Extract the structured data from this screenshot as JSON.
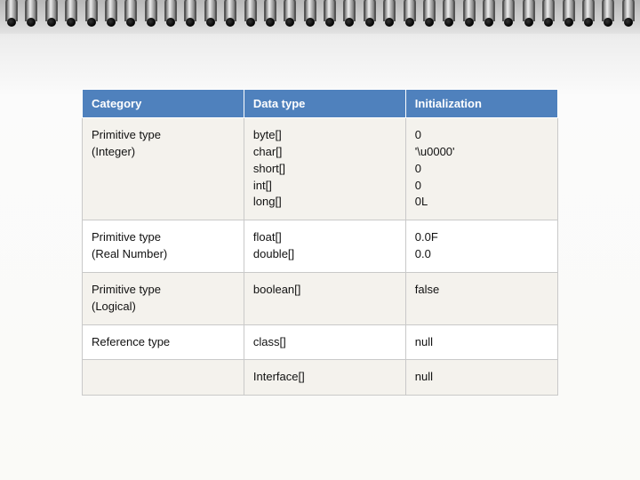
{
  "table": {
    "headers": {
      "category": "Category",
      "datatype": "Data type",
      "init": "Initialization"
    },
    "rows": [
      {
        "category": [
          "Primitive type",
          "(Integer)"
        ],
        "datatype": [
          "byte[]",
          "char[]",
          "short[]",
          "int[]",
          "long[]"
        ],
        "init": [
          "0",
          "'\\u0000'",
          "0",
          "0",
          "0L"
        ],
        "shade": true
      },
      {
        "category": [
          "Primitive type",
          "(Real Number)"
        ],
        "datatype": [
          "float[]",
          "double[]"
        ],
        "init": [
          "0.0F",
          "0.0"
        ],
        "shade": false
      },
      {
        "category": [
          "Primitive type",
          "(Logical)"
        ],
        "datatype": [
          "boolean[]"
        ],
        "init": [
          "false"
        ],
        "shade": true
      },
      {
        "category": [
          "Reference type"
        ],
        "datatype": [
          "class[]"
        ],
        "init": [
          "null"
        ],
        "shade": false
      },
      {
        "category": [
          ""
        ],
        "datatype": [
          "Interface[]"
        ],
        "init": [
          "null"
        ],
        "shade": true,
        "hide_category": true
      }
    ]
  },
  "chart_data": {
    "type": "table",
    "title": "",
    "columns": [
      "Category",
      "Data type",
      "Initialization"
    ],
    "rows": [
      [
        "Primitive type (Integer)",
        "byte[]",
        "0"
      ],
      [
        "Primitive type (Integer)",
        "char[]",
        "'\\u0000'"
      ],
      [
        "Primitive type (Integer)",
        "short[]",
        "0"
      ],
      [
        "Primitive type (Integer)",
        "int[]",
        "0"
      ],
      [
        "Primitive type (Integer)",
        "long[]",
        "0L"
      ],
      [
        "Primitive type (Real Number)",
        "float[]",
        "0.0F"
      ],
      [
        "Primitive type (Real Number)",
        "double[]",
        "0.0"
      ],
      [
        "Primitive type (Logical)",
        "boolean[]",
        "false"
      ],
      [
        "Reference type",
        "class[]",
        "null"
      ],
      [
        "Reference type",
        "Interface[]",
        "null"
      ]
    ]
  }
}
